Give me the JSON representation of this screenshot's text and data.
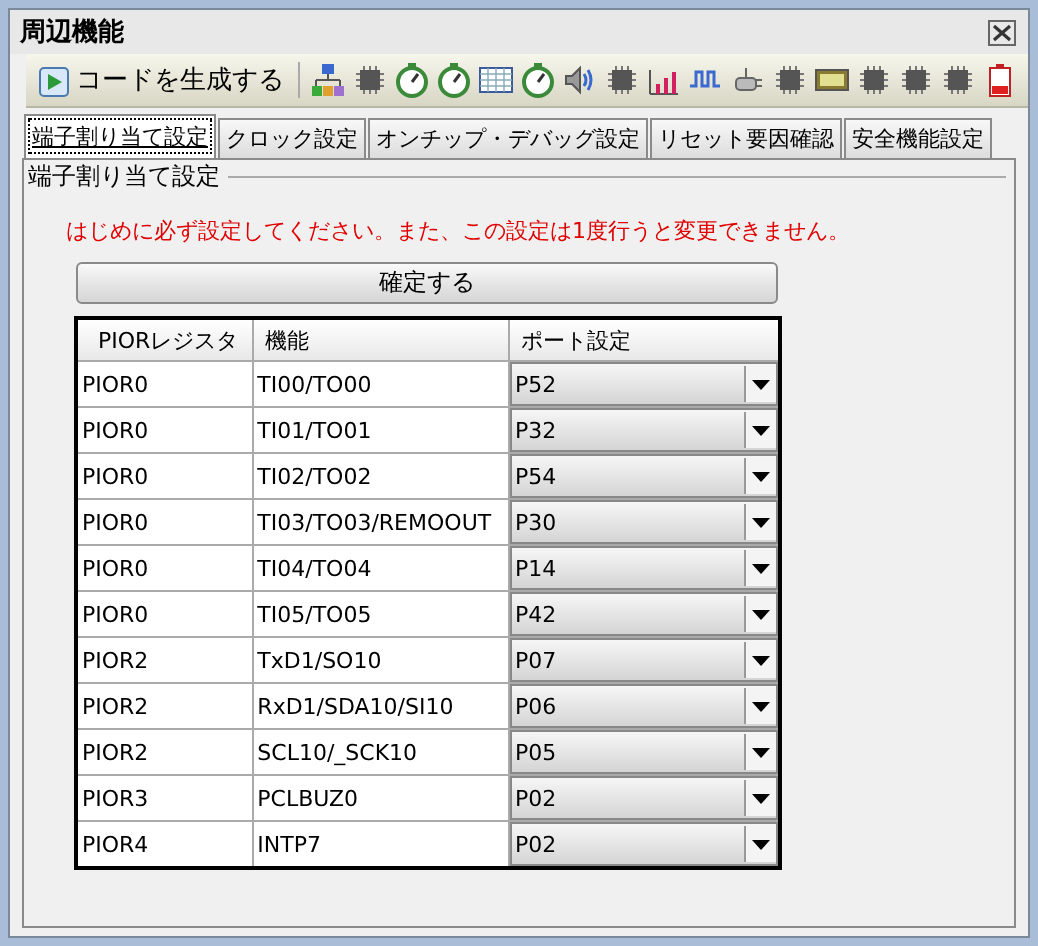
{
  "window": {
    "title": "周辺機能"
  },
  "toolbar": {
    "generate_button": "コードを生成する"
  },
  "tabs": [
    {
      "label": "端子割り当て設定",
      "selected": true
    },
    {
      "label": "クロック設定",
      "selected": false
    },
    {
      "label": "オンチップ・デバッグ設定",
      "selected": false
    },
    {
      "label": "リセット要因確認",
      "selected": false
    },
    {
      "label": "安全機能設定",
      "selected": false
    }
  ],
  "group": {
    "title": "端子割り当て設定",
    "notice": "はじめに必ず設定してください。また、この設定は1度行うと変更できません。",
    "confirm_button": "確定する"
  },
  "table": {
    "columns": [
      "PIORレジスタ",
      "機能",
      "ポート設定"
    ],
    "rows": [
      {
        "register": "PIOR0",
        "function": "TI00/TO00",
        "port": "P52"
      },
      {
        "register": "PIOR0",
        "function": "TI01/TO01",
        "port": "P32"
      },
      {
        "register": "PIOR0",
        "function": "TI02/TO02",
        "port": "P54"
      },
      {
        "register": "PIOR0",
        "function": "TI03/TO03/REMOOUT",
        "port": "P30"
      },
      {
        "register": "PIOR0",
        "function": "TI04/TO04",
        "port": "P14"
      },
      {
        "register": "PIOR0",
        "function": "TI05/TO05",
        "port": "P42"
      },
      {
        "register": "PIOR2",
        "function": "TxD1/SO10",
        "port": "P07"
      },
      {
        "register": "PIOR2",
        "function": "RxD1/SDA10/SI10",
        "port": "P06"
      },
      {
        "register": "PIOR2",
        "function": "SCL10/_SCK10",
        "port": "P05"
      },
      {
        "register": "PIOR3",
        "function": "PCLBUZ0",
        "port": "P02"
      },
      {
        "register": "PIOR4",
        "function": "INTP7",
        "port": "P02"
      }
    ]
  }
}
